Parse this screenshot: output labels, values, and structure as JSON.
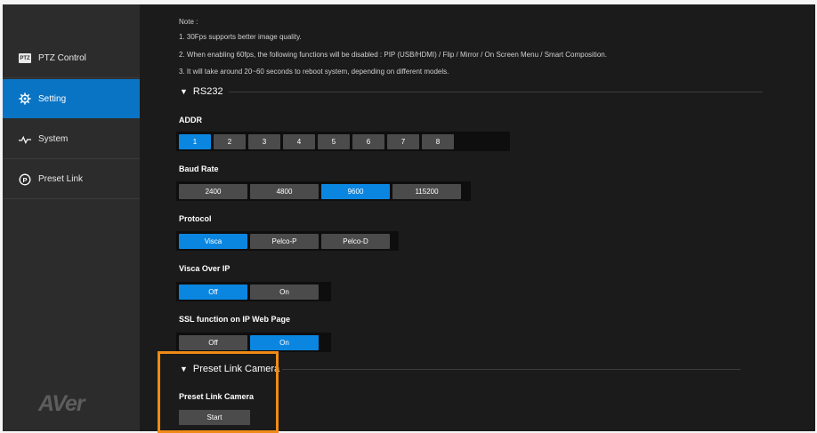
{
  "sidebar": {
    "items": [
      {
        "label": "PTZ Control",
        "icon": "ptz-icon",
        "badge": "PTZ"
      },
      {
        "label": "Setting",
        "icon": "gear-icon",
        "active": true
      },
      {
        "label": "System",
        "icon": "pulse-icon"
      },
      {
        "label": "Preset Link",
        "icon": "preset-link-icon"
      }
    ],
    "logo": "AVer"
  },
  "notes": {
    "title": "Note :",
    "lines": [
      "1. 30Fps supports better image quality.",
      "2. When enabling 60fps, the following functions will be disabled : PIP (USB/HDMI) / Flip / Mirror / On Screen Menu / Smart Composition.",
      "3. It will take around 20~60 seconds to reboot system, depending on different models."
    ]
  },
  "rs232": {
    "title": "RS232",
    "addr": {
      "label": "ADDR",
      "options": [
        "1",
        "2",
        "3",
        "4",
        "5",
        "6",
        "7",
        "8"
      ],
      "selected": "1"
    },
    "baud": {
      "label": "Baud Rate",
      "options": [
        "2400",
        "4800",
        "9600",
        "115200"
      ],
      "selected": "9600"
    },
    "protocol": {
      "label": "Protocol",
      "options": [
        "Visca",
        "Pelco-P",
        "Pelco-D"
      ],
      "selected": "Visca"
    },
    "visca_ip": {
      "label": "Visca Over IP",
      "options": [
        "Off",
        "On"
      ],
      "selected": "Off"
    },
    "ssl": {
      "label": "SSL function on IP Web Page",
      "options": [
        "Off",
        "On"
      ],
      "selected": "On"
    }
  },
  "preset_link": {
    "title": "Preset Link Camera",
    "label": "Preset Link Camera",
    "start_label": "Start"
  },
  "colors": {
    "accent": "#0b86e0",
    "sidebar_active": "#0a74c4",
    "highlight": "#f08a16"
  }
}
